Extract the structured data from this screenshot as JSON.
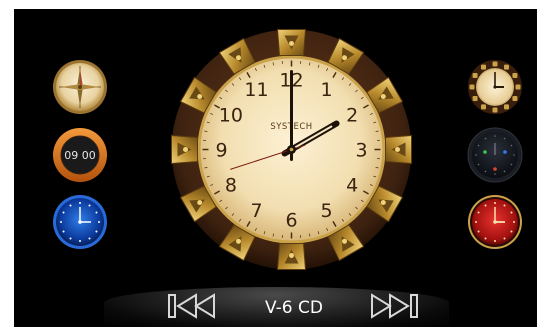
{
  "main_clock": {
    "brand": "SYSTECH",
    "numerals": [
      "12",
      "1",
      "2",
      "3",
      "4",
      "5",
      "6",
      "7",
      "8",
      "9",
      "10",
      "11"
    ],
    "time": {
      "hour": 2,
      "minute": 0,
      "second": 42
    }
  },
  "side_widgets": {
    "digital_time": "09 00"
  },
  "media": {
    "title": "V-6 CD",
    "prev_icon": "skip-previous-icon",
    "next_icon": "skip-next-icon"
  },
  "colors": {
    "background": "#000000",
    "dial_face": "#f4e2b8",
    "bezel": "#4a2a12",
    "gold": "#c9a24a",
    "title_text": "#ffffff"
  }
}
